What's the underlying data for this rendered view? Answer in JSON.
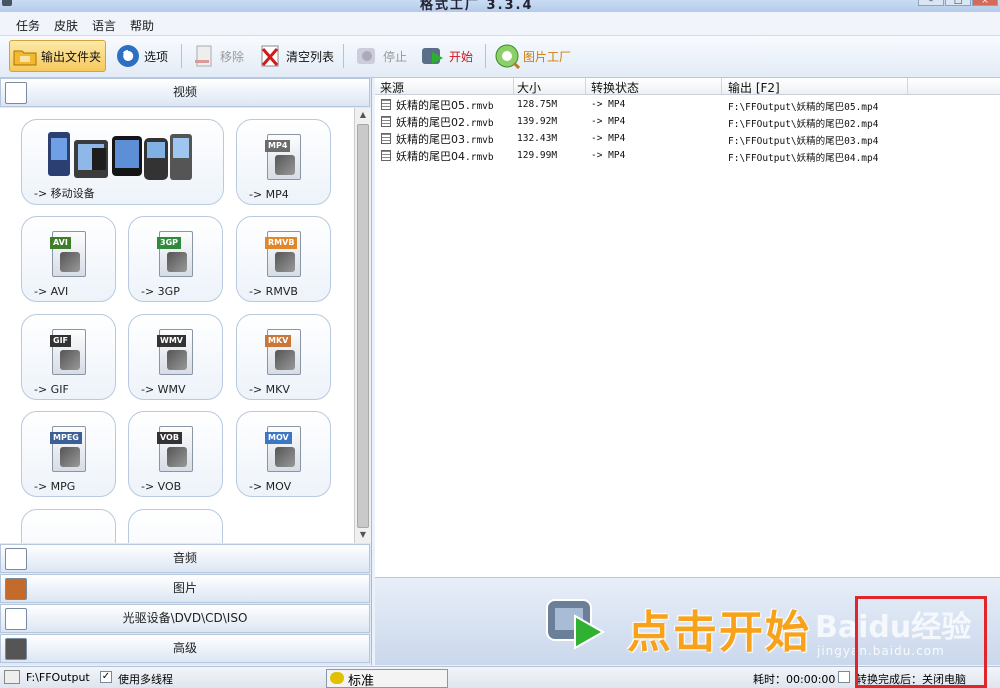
{
  "window": {
    "title": "格式工厂 3.3.4"
  },
  "menu": [
    "任务",
    "皮肤",
    "语言",
    "帮助"
  ],
  "toolbar": {
    "output_folder": "输出文件夹",
    "options": "选项",
    "remove": "移除",
    "clear_list": "清空列表",
    "stop": "停止",
    "start": "开始",
    "picture_factory": "图片工厂"
  },
  "categories": {
    "video": "视频",
    "audio": "音频",
    "picture": "图片",
    "rom": "光驱设备\\DVD\\CD\\ISO",
    "advanced": "高级"
  },
  "formats": [
    {
      "label": "-> 移动设备",
      "tag": "",
      "icon": "mobile-devices-icon"
    },
    {
      "label": "-> MP4",
      "tag": "MP4",
      "icon": "mp4-icon",
      "color": "#6b6b6b"
    },
    {
      "label": "-> AVI",
      "tag": "AVI",
      "icon": "avi-icon",
      "color": "#3f7d2a"
    },
    {
      "label": "-> 3GP",
      "tag": "3GP",
      "icon": "3gp-icon",
      "color": "#2f8a3a"
    },
    {
      "label": "-> RMVB",
      "tag": "RMVB",
      "icon": "rmvb-icon",
      "color": "#e2862a"
    },
    {
      "label": "-> GIF",
      "tag": "GIF",
      "icon": "gif-icon",
      "color": "#333333"
    },
    {
      "label": "-> WMV",
      "tag": "WMV",
      "icon": "wmv-icon",
      "color": "#333333"
    },
    {
      "label": "-> MKV",
      "tag": "MKV",
      "icon": "mkv-icon",
      "color": "#c8763a"
    },
    {
      "label": "-> MPG",
      "tag": "MPEG",
      "icon": "mpg-icon",
      "color": "#3b5f96"
    },
    {
      "label": "-> VOB",
      "tag": "VOB",
      "icon": "vob-icon",
      "color": "#333333"
    },
    {
      "label": "-> MOV",
      "tag": "MOV",
      "icon": "mov-icon",
      "color": "#3b77c4"
    }
  ],
  "list": {
    "columns": [
      "来源",
      "大小",
      "转换状态",
      "输出 [F2]"
    ],
    "rows": [
      {
        "source_name": "妖精的尾巴05",
        "source_ext": ".rmvb",
        "size": "128.75M",
        "status": "-> MP4",
        "output": "F:\\FFOutput\\妖精的尾巴05.mp4"
      },
      {
        "source_name": "妖精的尾巴02",
        "source_ext": ".rmvb",
        "size": "139.92M",
        "status": "-> MP4",
        "output": "F:\\FFOutput\\妖精的尾巴02.mp4"
      },
      {
        "source_name": "妖精的尾巴03",
        "source_ext": ".rmvb",
        "size": "132.43M",
        "status": "-> MP4",
        "output": "F:\\FFOutput\\妖精的尾巴03.mp4"
      },
      {
        "source_name": "妖精的尾巴04",
        "source_ext": ".rmvb",
        "size": "129.99M",
        "status": "-> MP4",
        "output": "F:\\FFOutput\\妖精的尾巴04.mp4"
      }
    ]
  },
  "banner": {
    "text": "点击开始",
    "watermark": "Baidu经验",
    "watermark_url": "jingyan.baidu.com"
  },
  "status": {
    "output_path": "F:\\FFOutput",
    "multithread": "使用多线程",
    "mode": "标准",
    "elapsed": "耗时：00:00:00",
    "after_done": "转换完成后：关闭电脑"
  },
  "colors": {
    "accent": "#f7a21a",
    "highlight_box": "#e0262b"
  }
}
